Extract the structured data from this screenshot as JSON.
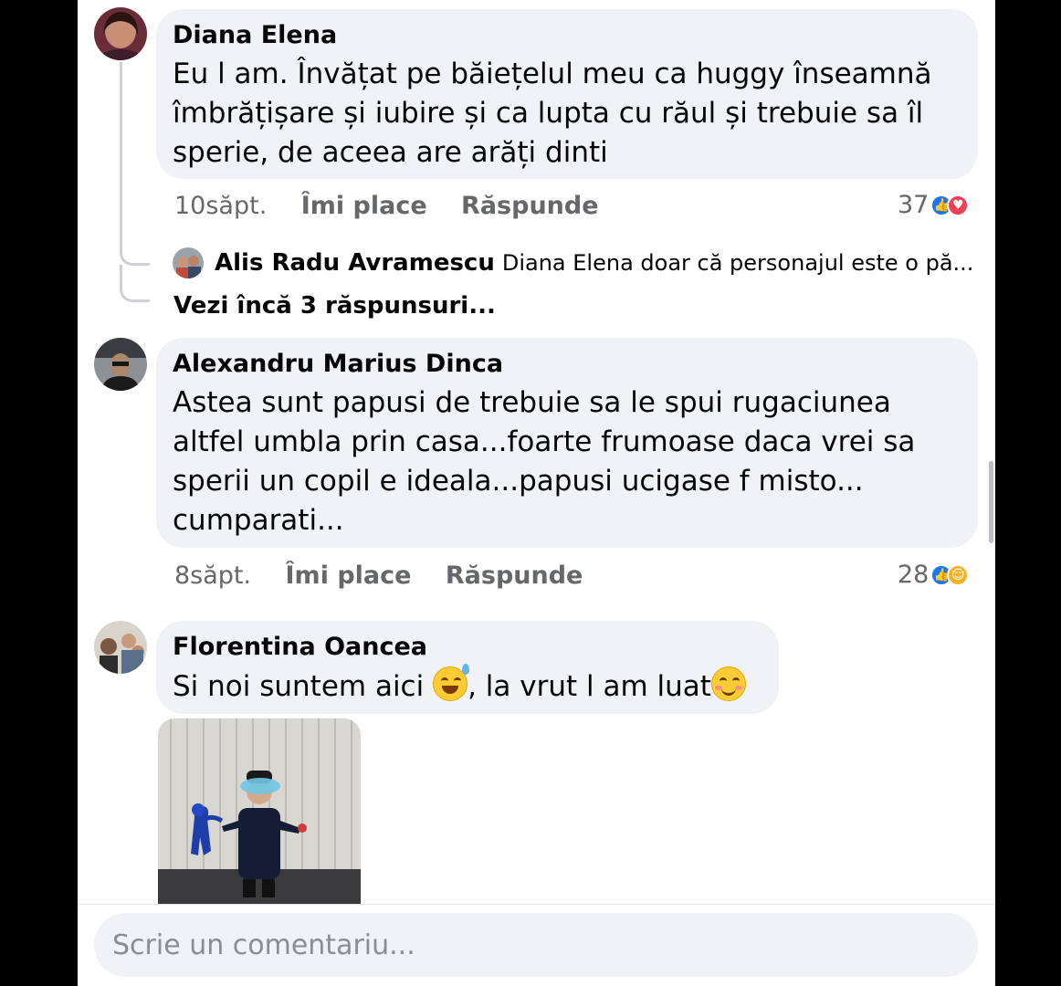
{
  "comments": [
    {
      "author": "Diana Elena",
      "text_lines": [
        "Eu l am. Învățat pe băiețelul meu ca huggy înseamnă",
        "îmbrățișare și iubire și ca lupta cu răul și trebuie sa îl",
        "sperie, de aceea are arăți dinti"
      ],
      "time": "10săpt.",
      "like_label": "Îmi place",
      "reply_label": "Răspunde",
      "reaction_count": "37",
      "reactions": [
        "like-icon",
        "love-icon"
      ]
    },
    {
      "author": "Alexandru Marius Dinca",
      "text_lines": [
        "Astea sunt papusi de trebuie sa le spui rugaciunea",
        "altfel umbla prin casa...foarte frumoase daca vrei sa",
        "sperii un copil e ideala...papusi ucigase f misto...",
        "cumparati..."
      ],
      "time": "8săpt.",
      "like_label": "Îmi place",
      "reply_label": "Răspunde",
      "reaction_count": "28",
      "reactions": [
        "like-icon",
        "haha-icon"
      ]
    },
    {
      "author": "Florentina Oancea",
      "text_before_emoji": "Si noi suntem aici ",
      "text_middle": ", la vrut l am luat",
      "emojis": [
        "grinning-sweat-emoji",
        "smiling-blush-emoji"
      ],
      "attachment": "photo-child-with-toy"
    }
  ],
  "reply": {
    "author": "Alis Radu Avramescu",
    "text": "Diana Elena doar că personajul este o pă..."
  },
  "more_replies": "Vezi încă 3 răspunsuri...",
  "composer": {
    "placeholder": "Scrie un comentariu..."
  },
  "colors": {
    "bubble": "#f0f2f5",
    "meta_text": "#65676b",
    "like_blue": "#1877f2",
    "love_red": "#f33e58"
  }
}
